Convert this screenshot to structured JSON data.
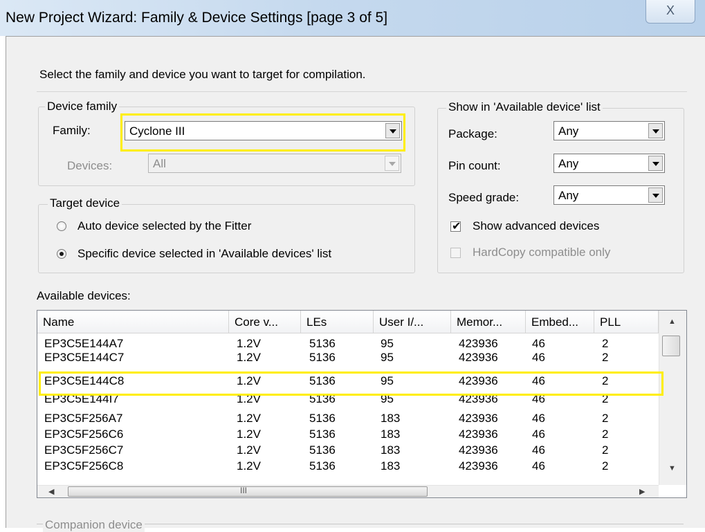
{
  "window": {
    "title": "New Project Wizard: Family & Device Settings [page 3 of 5]",
    "close_glyph": "X"
  },
  "instruction": "Select the family and device you want to target for compilation.",
  "device_family": {
    "group_title": "Device family",
    "family_label": "Family:",
    "family_value": "Cyclone III",
    "devices_label": "Devices:",
    "devices_value": "All"
  },
  "target_device": {
    "group_title": "Target device",
    "options": [
      {
        "label": "Auto device selected by the Fitter",
        "checked": false
      },
      {
        "label": "Specific device selected in 'Available devices' list",
        "checked": true
      }
    ]
  },
  "show_filter": {
    "group_title": "Show in 'Available device' list",
    "package_label": "Package:",
    "package_value": "Any",
    "pin_count_label": "Pin count:",
    "pin_count_value": "Any",
    "speed_grade_label": "Speed grade:",
    "speed_grade_value": "Any",
    "show_advanced_label": "Show advanced devices",
    "show_advanced_checked": true,
    "hardcopy_label": "HardCopy compatible only",
    "hardcopy_checked": false
  },
  "available_devices": {
    "label": "Available devices:",
    "columns": [
      "Name",
      "Core v...",
      "LEs",
      "User I/...",
      "Memor...",
      "Embed...",
      "PLL"
    ],
    "selected_row": 2,
    "rows": [
      [
        "EP3C5E144A7",
        "1.2V",
        "5136",
        "95",
        "423936",
        "46",
        "2"
      ],
      [
        "EP3C5E144C7",
        "1.2V",
        "5136",
        "95",
        "423936",
        "46",
        "2"
      ],
      [
        "EP3C5E144C8",
        "1.2V",
        "5136",
        "95",
        "423936",
        "46",
        "2"
      ],
      [
        "EP3C5E144I7",
        "1.2V",
        "5136",
        "95",
        "423936",
        "46",
        "2"
      ],
      [
        "EP3C5F256A7",
        "1.2V",
        "5136",
        "183",
        "423936",
        "46",
        "2"
      ],
      [
        "EP3C5F256C6",
        "1.2V",
        "5136",
        "183",
        "423936",
        "46",
        "2"
      ],
      [
        "EP3C5F256C7",
        "1.2V",
        "5136",
        "183",
        "423936",
        "46",
        "2"
      ],
      [
        "EP3C5F256C8",
        "1.2V",
        "5136",
        "183",
        "423936",
        "46",
        "2"
      ]
    ],
    "hscroll_grip": "III"
  },
  "companion_device": {
    "group_title": "Companion device"
  },
  "colors": {
    "highlight": "#ffee00",
    "dialog_bg": "#f0f0f0",
    "titlebar": "#c5d9ee"
  }
}
